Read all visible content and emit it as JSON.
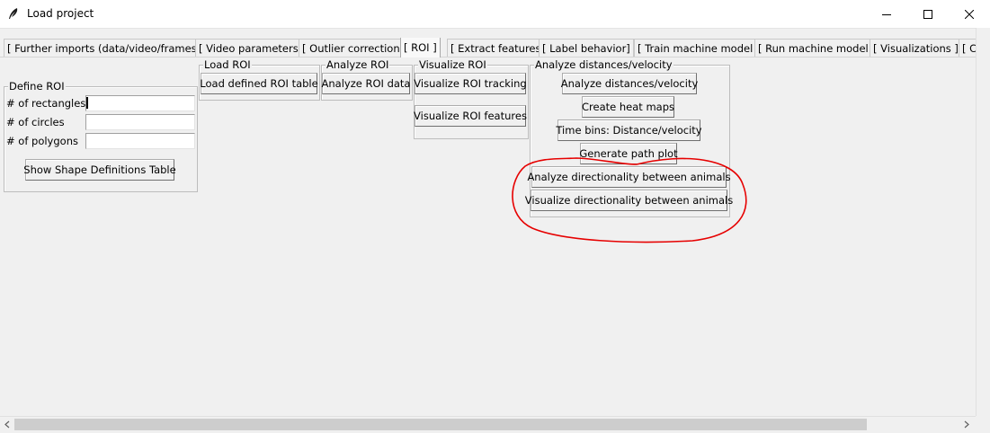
{
  "window": {
    "title": "Load project",
    "icon": "feather-icon",
    "controls": [
      "minimize-icon",
      "maximize-icon",
      "close-icon"
    ]
  },
  "tabs": [
    {
      "label": "[ Further imports (data/video/frames) ]"
    },
    {
      "label": "[ Video parameters ]"
    },
    {
      "label": "[ Outlier correction ]"
    },
    {
      "label": "[ ROI ]",
      "active": true
    },
    {
      "label": "[ Extract features ]"
    },
    {
      "label": "[ Label behavior]"
    },
    {
      "label": "[ Train machine model ]"
    },
    {
      "label": "[ Run machine model ]"
    },
    {
      "label": "[ Visualizations ]"
    },
    {
      "label": "[ C"
    }
  ],
  "define_roi": {
    "title": "Define ROI",
    "rectangles_label": "# of rectangles",
    "rectangles_value": "",
    "circles_label": "# of circles",
    "circles_value": "",
    "polygons_label": "# of polygons",
    "polygons_value": "",
    "show_table_button": "Show Shape Definitions Table"
  },
  "load_roi": {
    "title": "Load ROI",
    "load_button": "Load defined ROI table"
  },
  "analyze_roi": {
    "title": "Analyze ROI",
    "analyze_button": "Analyze ROI data"
  },
  "visualize_roi": {
    "title": "Visualize ROI",
    "tracking_button": "Visualize ROI tracking",
    "features_button": "Visualize ROI features"
  },
  "analyze_distances": {
    "title": "Analyze distances/velocity",
    "analyze_button": "Analyze distances/velocity",
    "heatmap_button": "Create heat maps",
    "timebins_button": "Time bins: Distance/velocity",
    "pathplot_button": "Generate path plot",
    "directionality_analyze_button": "Analyze directionality between animals",
    "directionality_visualize_button": "Visualize directionality between animals"
  },
  "colors": {
    "annotation": "#e60000",
    "window_bg": "#f0f0f0",
    "titlebar_bg": "#ffffff"
  }
}
